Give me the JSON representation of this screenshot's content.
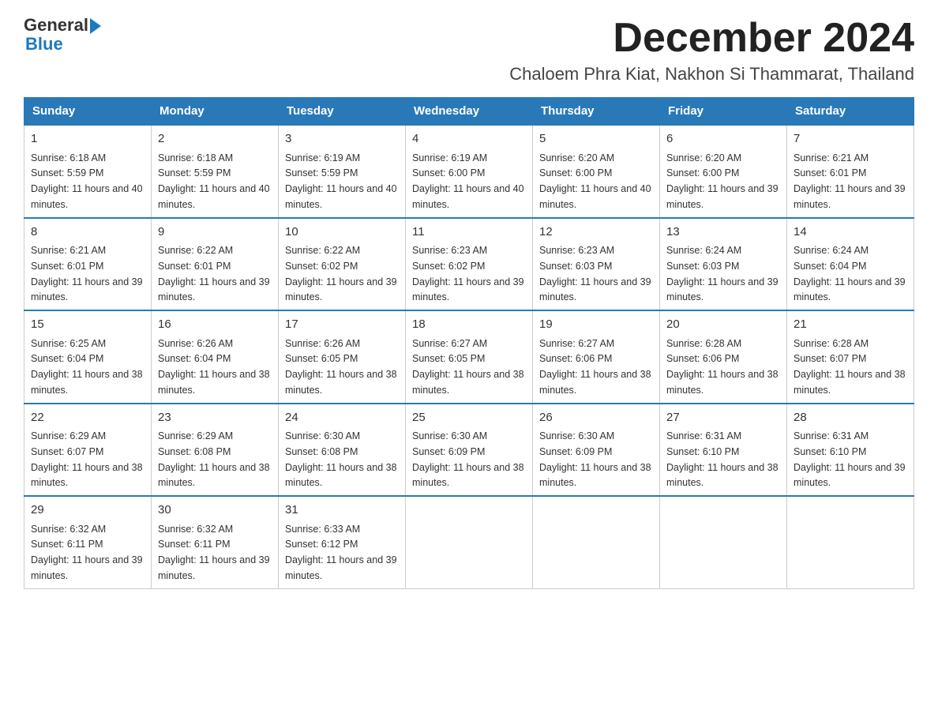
{
  "logo": {
    "text_general": "General",
    "text_blue": "Blue"
  },
  "header": {
    "month_title": "December 2024",
    "subtitle": "Chaloem Phra Kiat, Nakhon Si Thammarat, Thailand"
  },
  "days_of_week": [
    "Sunday",
    "Monday",
    "Tuesday",
    "Wednesday",
    "Thursday",
    "Friday",
    "Saturday"
  ],
  "weeks": [
    [
      {
        "day": "1",
        "sunrise": "6:18 AM",
        "sunset": "5:59 PM",
        "daylight": "11 hours and 40 minutes."
      },
      {
        "day": "2",
        "sunrise": "6:18 AM",
        "sunset": "5:59 PM",
        "daylight": "11 hours and 40 minutes."
      },
      {
        "day": "3",
        "sunrise": "6:19 AM",
        "sunset": "5:59 PM",
        "daylight": "11 hours and 40 minutes."
      },
      {
        "day": "4",
        "sunrise": "6:19 AM",
        "sunset": "6:00 PM",
        "daylight": "11 hours and 40 minutes."
      },
      {
        "day": "5",
        "sunrise": "6:20 AM",
        "sunset": "6:00 PM",
        "daylight": "11 hours and 40 minutes."
      },
      {
        "day": "6",
        "sunrise": "6:20 AM",
        "sunset": "6:00 PM",
        "daylight": "11 hours and 39 minutes."
      },
      {
        "day": "7",
        "sunrise": "6:21 AM",
        "sunset": "6:01 PM",
        "daylight": "11 hours and 39 minutes."
      }
    ],
    [
      {
        "day": "8",
        "sunrise": "6:21 AM",
        "sunset": "6:01 PM",
        "daylight": "11 hours and 39 minutes."
      },
      {
        "day": "9",
        "sunrise": "6:22 AM",
        "sunset": "6:01 PM",
        "daylight": "11 hours and 39 minutes."
      },
      {
        "day": "10",
        "sunrise": "6:22 AM",
        "sunset": "6:02 PM",
        "daylight": "11 hours and 39 minutes."
      },
      {
        "day": "11",
        "sunrise": "6:23 AM",
        "sunset": "6:02 PM",
        "daylight": "11 hours and 39 minutes."
      },
      {
        "day": "12",
        "sunrise": "6:23 AM",
        "sunset": "6:03 PM",
        "daylight": "11 hours and 39 minutes."
      },
      {
        "day": "13",
        "sunrise": "6:24 AM",
        "sunset": "6:03 PM",
        "daylight": "11 hours and 39 minutes."
      },
      {
        "day": "14",
        "sunrise": "6:24 AM",
        "sunset": "6:04 PM",
        "daylight": "11 hours and 39 minutes."
      }
    ],
    [
      {
        "day": "15",
        "sunrise": "6:25 AM",
        "sunset": "6:04 PM",
        "daylight": "11 hours and 38 minutes."
      },
      {
        "day": "16",
        "sunrise": "6:26 AM",
        "sunset": "6:04 PM",
        "daylight": "11 hours and 38 minutes."
      },
      {
        "day": "17",
        "sunrise": "6:26 AM",
        "sunset": "6:05 PM",
        "daylight": "11 hours and 38 minutes."
      },
      {
        "day": "18",
        "sunrise": "6:27 AM",
        "sunset": "6:05 PM",
        "daylight": "11 hours and 38 minutes."
      },
      {
        "day": "19",
        "sunrise": "6:27 AM",
        "sunset": "6:06 PM",
        "daylight": "11 hours and 38 minutes."
      },
      {
        "day": "20",
        "sunrise": "6:28 AM",
        "sunset": "6:06 PM",
        "daylight": "11 hours and 38 minutes."
      },
      {
        "day": "21",
        "sunrise": "6:28 AM",
        "sunset": "6:07 PM",
        "daylight": "11 hours and 38 minutes."
      }
    ],
    [
      {
        "day": "22",
        "sunrise": "6:29 AM",
        "sunset": "6:07 PM",
        "daylight": "11 hours and 38 minutes."
      },
      {
        "day": "23",
        "sunrise": "6:29 AM",
        "sunset": "6:08 PM",
        "daylight": "11 hours and 38 minutes."
      },
      {
        "day": "24",
        "sunrise": "6:30 AM",
        "sunset": "6:08 PM",
        "daylight": "11 hours and 38 minutes."
      },
      {
        "day": "25",
        "sunrise": "6:30 AM",
        "sunset": "6:09 PM",
        "daylight": "11 hours and 38 minutes."
      },
      {
        "day": "26",
        "sunrise": "6:30 AM",
        "sunset": "6:09 PM",
        "daylight": "11 hours and 38 minutes."
      },
      {
        "day": "27",
        "sunrise": "6:31 AM",
        "sunset": "6:10 PM",
        "daylight": "11 hours and 38 minutes."
      },
      {
        "day": "28",
        "sunrise": "6:31 AM",
        "sunset": "6:10 PM",
        "daylight": "11 hours and 39 minutes."
      }
    ],
    [
      {
        "day": "29",
        "sunrise": "6:32 AM",
        "sunset": "6:11 PM",
        "daylight": "11 hours and 39 minutes."
      },
      {
        "day": "30",
        "sunrise": "6:32 AM",
        "sunset": "6:11 PM",
        "daylight": "11 hours and 39 minutes."
      },
      {
        "day": "31",
        "sunrise": "6:33 AM",
        "sunset": "6:12 PM",
        "daylight": "11 hours and 39 minutes."
      },
      null,
      null,
      null,
      null
    ]
  ]
}
